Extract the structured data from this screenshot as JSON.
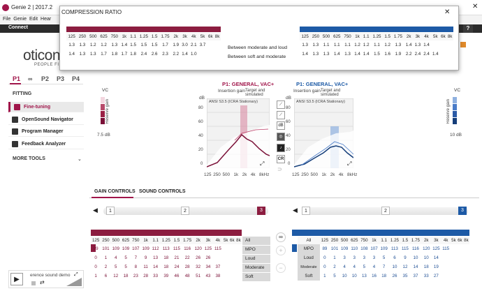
{
  "app": {
    "title": "Genie 2 | 2017.2",
    "menu": [
      "File",
      "Genie",
      "Edit",
      "Hear"
    ],
    "connect": "Connect",
    "logo": "oticon",
    "logo_sub": "PEOPLE FI"
  },
  "programs": {
    "tabs": [
      "P1",
      "∞",
      "P2",
      "P3",
      "P4"
    ],
    "active": "P1"
  },
  "sidebar": {
    "fitting_label": "FITTING",
    "items": [
      {
        "label": "Fine-tuning",
        "icon": "sliders-icon"
      },
      {
        "label": "OpenSound Navigator",
        "icon": "navigator-icon"
      },
      {
        "label": "Program Manager",
        "icon": "program-icon"
      },
      {
        "label": "Feedback Analyzer",
        "icon": "feedback-icon"
      }
    ],
    "more_tools": "MORE TOOLS"
  },
  "reserve": {
    "left_vc": "VC",
    "left_db": "7.5 dB",
    "left_label": "Reserve gain",
    "right_vc": "VC",
    "right_db": "10 dB",
    "right_label": "Reserve gain"
  },
  "charts": {
    "left": {
      "title": "P1: GENERAL, VAC+",
      "subtitle": "Insertion gain",
      "target": "Target and simulated",
      "standard": "ANSI S3.5 (ICRA Stationary)",
      "ylabel": "dB",
      "y_ticks": [
        "80",
        "60",
        "40",
        "20",
        "0"
      ],
      "x_ticks": [
        "125",
        "250",
        "500",
        "1k",
        "2k",
        "4k",
        "8kHz"
      ]
    },
    "right": {
      "title": "P1: GENERAL, VAC+",
      "subtitle": "Insertion gain",
      "target": "Target and simulated",
      "standard": "ANSI S3.5 (ICRA Stationary)",
      "ylabel": "dB",
      "y_ticks": [
        "80",
        "60",
        "40",
        "20",
        "0"
      ],
      "x_ticks": [
        "125",
        "250",
        "500",
        "1k",
        "2k",
        "4k",
        "8kHz"
      ]
    }
  },
  "tools": [
    "dB",
    "CR"
  ],
  "gain_tabs": [
    "GAIN CONTROLS",
    "SOUND CONTROLS"
  ],
  "slider": {
    "left": [
      "1",
      "2",
      "3"
    ],
    "right": [
      "1",
      "2",
      "3"
    ],
    "selected": "3"
  },
  "left_table": {
    "freqs": [
      "125",
      "250",
      "500",
      "625",
      "750",
      "1k",
      "1.1",
      "1.25",
      "1.5",
      "1.75",
      "2k",
      "3k",
      "4k",
      "5k",
      "6k",
      "8k"
    ],
    "rows": [
      [
        "89",
        "101",
        "109",
        "109",
        "107",
        "109",
        "112",
        "113",
        "115",
        "116",
        "120",
        "125",
        "115",
        "",
        "",
        ""
      ],
      [
        "0",
        "1",
        "4",
        "5",
        "7",
        "9",
        "13",
        "18",
        "21",
        "22",
        "26",
        "26",
        "",
        "",
        "",
        ""
      ],
      [
        "0",
        "2",
        "5",
        "5",
        "8",
        "11",
        "14",
        "18",
        "24",
        "28",
        "32",
        "34",
        "37",
        "",
        "",
        ""
      ],
      [
        "1",
        "6",
        "12",
        "18",
        "23",
        "28",
        "33",
        "39",
        "46",
        "48",
        "51",
        "43",
        "38",
        "",
        "",
        ""
      ]
    ],
    "labels": [
      "All",
      "MPO",
      "Loud",
      "Moderate",
      "Soft"
    ]
  },
  "right_table": {
    "freqs": [
      "All",
      "125",
      "250",
      "500",
      "625",
      "750",
      "1k",
      "1.1",
      "1.25",
      "1.5",
      "1.75",
      "2k",
      "3k",
      "4k",
      "5k",
      "6k",
      "8k"
    ],
    "rows": [
      [
        "89",
        "101",
        "109",
        "110",
        "108",
        "107",
        "109",
        "113",
        "115",
        "116",
        "120",
        "125",
        "115",
        "",
        "",
        ""
      ],
      [
        "0",
        "1",
        "3",
        "3",
        "3",
        "3",
        "5",
        "6",
        "9",
        "10",
        "10",
        "14",
        "",
        "",
        "",
        ""
      ],
      [
        "0",
        "2",
        "4",
        "4",
        "5",
        "4",
        "7",
        "10",
        "12",
        "14",
        "18",
        "19",
        "",
        "",
        "",
        ""
      ],
      [
        "1",
        "5",
        "10",
        "10",
        "13",
        "16",
        "18",
        "26",
        "35",
        "37",
        "33",
        "27",
        "",
        "",
        "",
        ""
      ]
    ],
    "labels": [
      "MPO",
      "Loud",
      "Moderate",
      "Soft"
    ]
  },
  "dialog": {
    "title": "COMPRESSION RATIO",
    "close": "✕",
    "freqs": [
      "125",
      "250",
      "500",
      "625",
      "750",
      "1k",
      "1.1",
      "1.25",
      "1.5",
      "1.75",
      "2k",
      "3k",
      "4k",
      "5k",
      "6k",
      "8k"
    ],
    "left_rows": [
      [
        "1.3",
        "1.3",
        "1.2",
        "1.2",
        "1.3",
        "1.4",
        "1.5",
        "1.5",
        "1.5",
        "1.7",
        "1.9",
        "3.0",
        "2.1",
        "3.7",
        "",
        ""
      ],
      [
        "1.4",
        "1.3",
        "1.3",
        "1.7",
        "1.8",
        "1.7",
        "1.8",
        "2.4",
        "2.6",
        "2.3",
        "2.2",
        "1.4",
        "1.0",
        "",
        "",
        ""
      ]
    ],
    "right_rows": [
      [
        "1.3",
        "1.3",
        "1.1",
        "1.1",
        "1.1",
        "1.2",
        "1.2",
        "1.1",
        "1.2",
        "1.3",
        "1.4",
        "1.3",
        "1.4",
        "",
        "",
        ""
      ],
      [
        "1.4",
        "1.3",
        "1.3",
        "1.4",
        "1.3",
        "1.4",
        "1.4",
        "1.5",
        "1.6",
        "1.9",
        "2.2",
        "2.4",
        "2.4",
        "1.4",
        "",
        ""
      ]
    ],
    "labels": [
      "Between moderate and loud",
      "Between soft and moderate"
    ]
  },
  "player": {
    "label": "erence sound demo"
  },
  "help": "?",
  "window_close": "✕",
  "accent": "#8c1d40",
  "accent_blue": "#1d5aa6"
}
